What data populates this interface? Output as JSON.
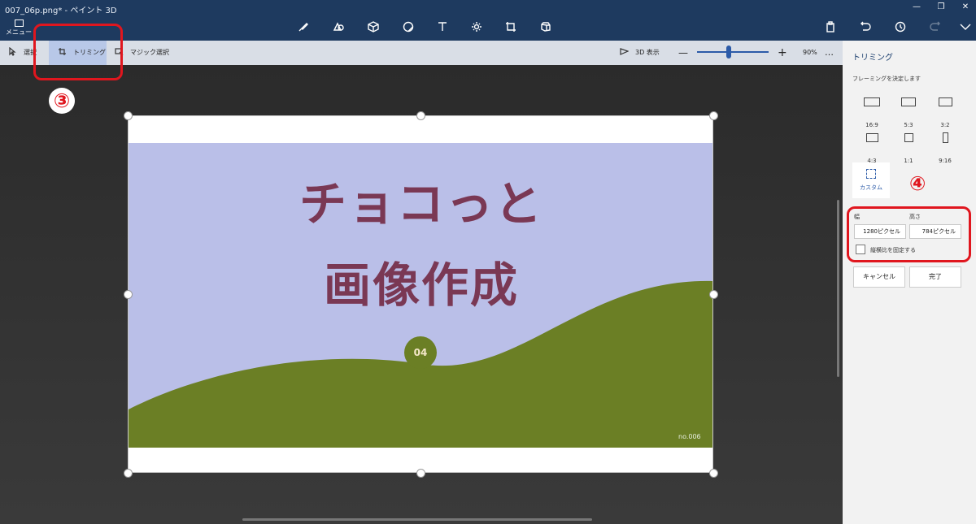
{
  "window": {
    "title": "007_06p.png* - ペイント 3D"
  },
  "menu": {
    "label": "メニュー"
  },
  "toolbar_icons": [
    "brush-icon",
    "2d-shapes-icon",
    "3d-shapes-icon",
    "sticker-icon",
    "text-icon",
    "effects-icon",
    "canvas-icon",
    "3d-library-icon"
  ],
  "right_icons": [
    "paste-icon",
    "undo-icon",
    "history-icon",
    "redo-icon",
    "expand-icon"
  ],
  "subtoolbar": {
    "select": "選択",
    "crop": "トリミング",
    "magic_select": "マジック選択",
    "view3d": "3D 表示",
    "zoom_minus": "—",
    "zoom_plus": "+",
    "zoom_level": "90%",
    "more": "…"
  },
  "zoom": {
    "level_fraction": 0.45
  },
  "annotations": {
    "step3": "③",
    "step4": "④"
  },
  "image": {
    "title_line1": "チョコっと",
    "title_line2": "画像作成",
    "badge": "04",
    "footer": "no.006",
    "bg_color": "#babfe8",
    "hill_color": "#6b7f25",
    "title_color": "#7a3854"
  },
  "panel": {
    "title": "トリミング",
    "description": "フレーミングを決定します",
    "ratios": [
      "16:9",
      "5:3",
      "3:2",
      "4:3",
      "1:1",
      "9:16"
    ],
    "custom_label": "カスタム",
    "width_label": "幅",
    "height_label": "高さ",
    "width_value": "1280ピクセル",
    "height_value": "784ピクセル",
    "lock_label": "縦横比を固定する",
    "cancel_label": "キャンセル",
    "done_label": "完了"
  },
  "colors": {
    "accent": "#2c5ba8",
    "titlebar": "#1e3a5f",
    "annotation": "#e0161e"
  }
}
